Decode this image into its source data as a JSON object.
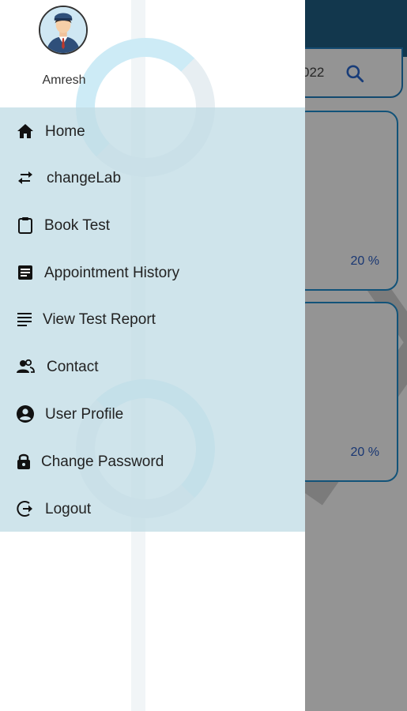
{
  "background": {
    "search_text": "022",
    "cards": [
      {
        "percent": "20 %"
      },
      {
        "percent": "20 %"
      }
    ]
  },
  "drawer": {
    "user": {
      "name": "Amresh"
    },
    "menu": [
      {
        "label": "Home",
        "icon": "home-icon"
      },
      {
        "label": "changeLab",
        "icon": "swap-icon"
      },
      {
        "label": "Book Test",
        "icon": "clipboard-icon"
      },
      {
        "label": "Appointment History",
        "icon": "document-list-icon"
      },
      {
        "label": "View Test Report",
        "icon": "lines-icon"
      },
      {
        "label": "Contact",
        "icon": "contacts-icon"
      },
      {
        "label": "User Profile",
        "icon": "account-circle-icon"
      },
      {
        "label": "Change Password",
        "icon": "lock-icon"
      },
      {
        "label": "Logout",
        "icon": "logout-icon"
      }
    ]
  },
  "colors": {
    "header": "#1f5f86",
    "accent": "#1f8fd0",
    "menu_bg": "#c1dde6",
    "percent_text": "#2b5fc7"
  }
}
